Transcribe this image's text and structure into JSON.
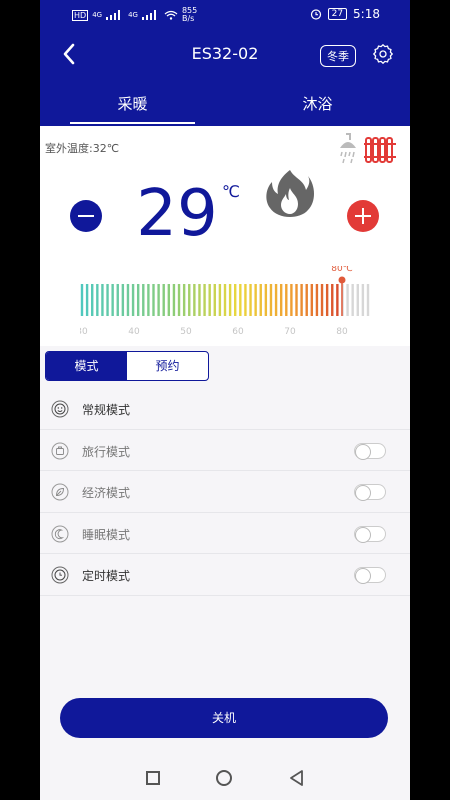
{
  "status_bar": {
    "left_badges": [
      "HD",
      "4G",
      "4G"
    ],
    "speed_value": "855",
    "speed_unit": "B/s",
    "battery": "27",
    "time": "5:18"
  },
  "header": {
    "title": "ES32-02",
    "season_badge": "冬季",
    "tabs": [
      {
        "label": "采暖",
        "active": true
      },
      {
        "label": "沐浴",
        "active": false
      }
    ]
  },
  "main": {
    "outdoor_temp": "室外温度:32℃",
    "current_temp": "29",
    "unit": "℃",
    "gauge": {
      "ticks": [
        "30",
        "40",
        "50",
        "60",
        "70",
        "80"
      ],
      "marker_label": "80℃",
      "min": 30,
      "max": 85,
      "value": 80
    }
  },
  "mode_section": {
    "segments": [
      {
        "label": "模式",
        "active": true
      },
      {
        "label": "预约",
        "active": false
      }
    ],
    "modes": [
      {
        "label": "常规模式",
        "icon": "smile-icon",
        "toggle": false
      },
      {
        "label": "旅行模式",
        "icon": "luggage-icon",
        "toggle": true
      },
      {
        "label": "经济模式",
        "icon": "leaf-icon",
        "toggle": true
      },
      {
        "label": "睡眠模式",
        "icon": "moon-icon",
        "toggle": true
      },
      {
        "label": "定时模式",
        "icon": "clock-icon",
        "toggle": true
      }
    ]
  },
  "power_button": "关机",
  "colors": {
    "primary": "#10189a",
    "accent_red": "#e23a37",
    "background": "#f6f5f8"
  }
}
